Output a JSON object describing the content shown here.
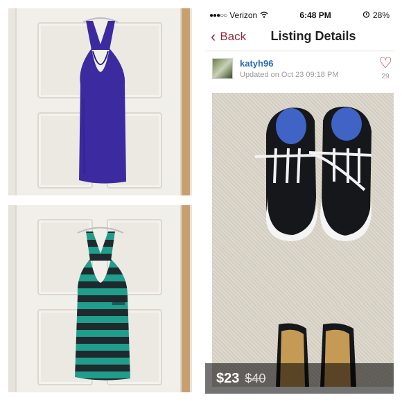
{
  "status_bar": {
    "carrier": "Verizon",
    "time": "6:48 PM",
    "battery": "28%"
  },
  "nav": {
    "back_label": "Back",
    "title": "Listing Details"
  },
  "listing": {
    "username": "katyh96",
    "updated": "Updated on Oct 23 09:18 PM",
    "likes": "29",
    "price": "$23",
    "original_price": "$40"
  },
  "colors": {
    "accent": "#8c2a3b",
    "link": "#2a6ab4",
    "dress": "#3c2aa0",
    "stripe_teal": "#1f9e8c",
    "stripe_dark": "#1e2a2e"
  },
  "icons": [
    "wifi-icon",
    "alarm-icon",
    "battery-icon",
    "chevron-left-icon",
    "heart-icon"
  ]
}
